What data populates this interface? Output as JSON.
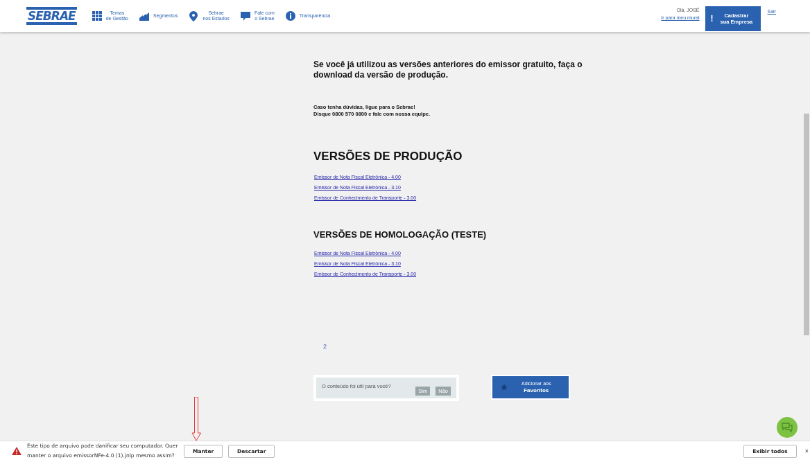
{
  "header": {
    "logo": "SEBRAE",
    "nav": [
      {
        "kind": "grid",
        "label": "Temas\nde Gestão"
      },
      {
        "kind": "chart",
        "label": "Segmentos"
      },
      {
        "kind": "pin",
        "label": "Sebrae\nnos Estados"
      },
      {
        "kind": "chat",
        "label": "Fale com\no Sebrae"
      },
      {
        "kind": "info",
        "label": "Transparência"
      }
    ],
    "greeting": "Olá, JOSÉ",
    "mural_link": "Ir para meu mural",
    "register_button": {
      "icon": "!",
      "label": "Cadastrar\nsua Empresa"
    },
    "logout": "Sair"
  },
  "content": {
    "intro": "Se você já utilizou as versões anteriores do emissor gratuito, faça o download da versão de produção.",
    "contact": [
      "Caso tenha dúvidas, ligue para o Sebrae!",
      "Disque 0800 570 0800 e fale com nossa equipe."
    ],
    "sections": [
      {
        "heading": "VERSÕES DE PRODUÇÃO",
        "kind": "large",
        "links": [
          "Emissor de Nota Fiscal Eletrônica - 4.00",
          "Emissor de Nota Fiscal Eletrônica - 3.10",
          "Emissor de Conhecimento de Transporte - 3.00"
        ]
      },
      {
        "heading": "VERSÕES DE HOMOLOGAÇÃO (TESTE)",
        "kind": "medium",
        "links": [
          "Emissor de Nota Fiscal Eletrônica - 4.00",
          "Emissor de Nota Fiscal Eletrônica - 3.10",
          "Emissor de Conhecimento de Transporte - 3.00"
        ]
      }
    ],
    "page_number": "2",
    "feedback": {
      "question": "O conteúdo foi útil para você?",
      "buttons": [
        "Sim",
        "Não"
      ]
    },
    "favorites": {
      "small": "Adicionar aos",
      "large": "Favoritos"
    }
  },
  "download_bar": {
    "message": "Este tipo de arquivo pode danificar seu computador. Quer manter o arquivo emissorNFe-4.0 (1).jnlp mesmo assim?",
    "buttons": [
      "Manter",
      "Descartar"
    ],
    "show_all": "Exibir todos",
    "close": "×"
  }
}
